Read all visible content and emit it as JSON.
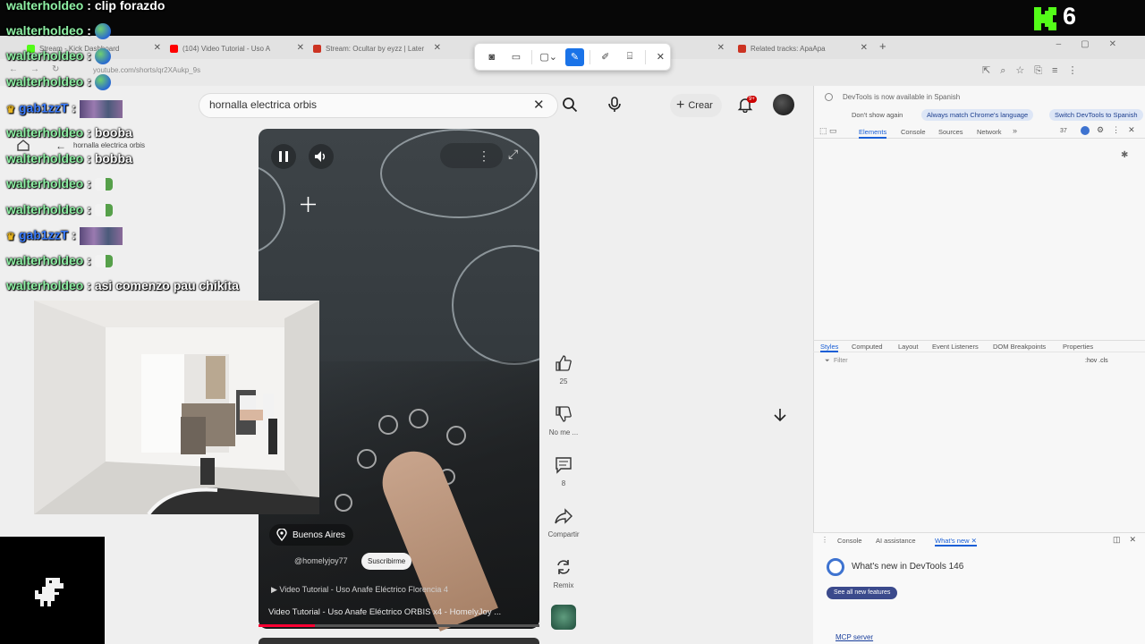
{
  "stream": {
    "viewer_count": "6",
    "brand_color": "#53fc18",
    "chat": [
      {
        "user": "walterholdeo",
        "text": "clip forazdo",
        "emote": ""
      },
      {
        "user": "walterholdeo",
        "text": "",
        "emote": "globe"
      },
      {
        "user": "walterholdeo",
        "text": "",
        "emote": "globe"
      },
      {
        "user": "walterholdeo",
        "text": "",
        "emote": "globe"
      },
      {
        "user": "gab1zzT",
        "text": "",
        "emote": "wide",
        "vip": true
      },
      {
        "user": "walterholdeo",
        "text": "booba",
        "emote": ""
      },
      {
        "user": "walterholdeo",
        "text": "bobba",
        "emote": ""
      },
      {
        "user": "walterholdeo",
        "text": "",
        "emote": "pepe"
      },
      {
        "user": "walterholdeo",
        "text": "",
        "emote": "pepe"
      },
      {
        "user": "gab1zzT",
        "text": "",
        "emote": "wide",
        "vip": true
      },
      {
        "user": "walterholdeo",
        "text": "",
        "emote": "pepe"
      },
      {
        "user": "walterholdeo",
        "text": "asi comenzo pau chikita",
        "emote": ""
      }
    ]
  },
  "browser": {
    "tabs": [
      {
        "label": "Stream - Kick Dashboard",
        "color": "#53fc18"
      },
      {
        "label": "(104) Video Tutorial - Uso A",
        "color": "#ff0000"
      },
      {
        "label": "Stream: Ocultar by eyzz | Later",
        "color": "#cc3322"
      },
      {
        "label": "Related tracks: ApaApa",
        "color": "#cc3322"
      }
    ],
    "url": "youtube.com/shorts/qr2XAukp_9s"
  },
  "snip_toolbar": {
    "buttons": [
      "screenshot",
      "video",
      "rectangle",
      "annotate",
      "pen",
      "text-extract",
      "close"
    ]
  },
  "youtube": {
    "search_query": "hornalla electrica orbis",
    "create_label": "Crear",
    "notifications": "9+",
    "back_query": "hornalla electrica orbis",
    "video": {
      "location": "Buenos Aires",
      "channel": "@homelyjoy77",
      "subscribe_label": "Suscribirme",
      "audio": "Video Tutorial - Uso Anafe Eléctrico Florencia 4",
      "title": "Video Tutorial - Uso Anafe Eléctrico ORBIS x4 - HomelyJoy ...",
      "progress": 0.2
    },
    "actions": {
      "likes": "25",
      "dislike_label": "No me ...",
      "comments": "8",
      "share_label": "Compartir",
      "remix_label": "Remix"
    }
  },
  "devtools": {
    "banner": "DevTools is now available in Spanish",
    "dont_show": "Don't show again",
    "match_lang": "Always match Chrome's language",
    "switch": "Switch DevTools to Spanish",
    "tabs": [
      "Elements",
      "Console",
      "Sources",
      "Network"
    ],
    "issue_count": "37",
    "styles_tabs": [
      "Styles",
      "Computed",
      "Layout",
      "Event Listeners",
      "DOM Breakpoints",
      "Properties"
    ],
    "filter_placeholder": "Filter",
    "filter_right": ":hov .cls",
    "drawer_tabs": [
      "Console",
      "AI assistance",
      "What's new"
    ],
    "whats_new_title": "What's new in DevTools 146",
    "see_all": "See all new features",
    "mcp": "MCP server"
  }
}
